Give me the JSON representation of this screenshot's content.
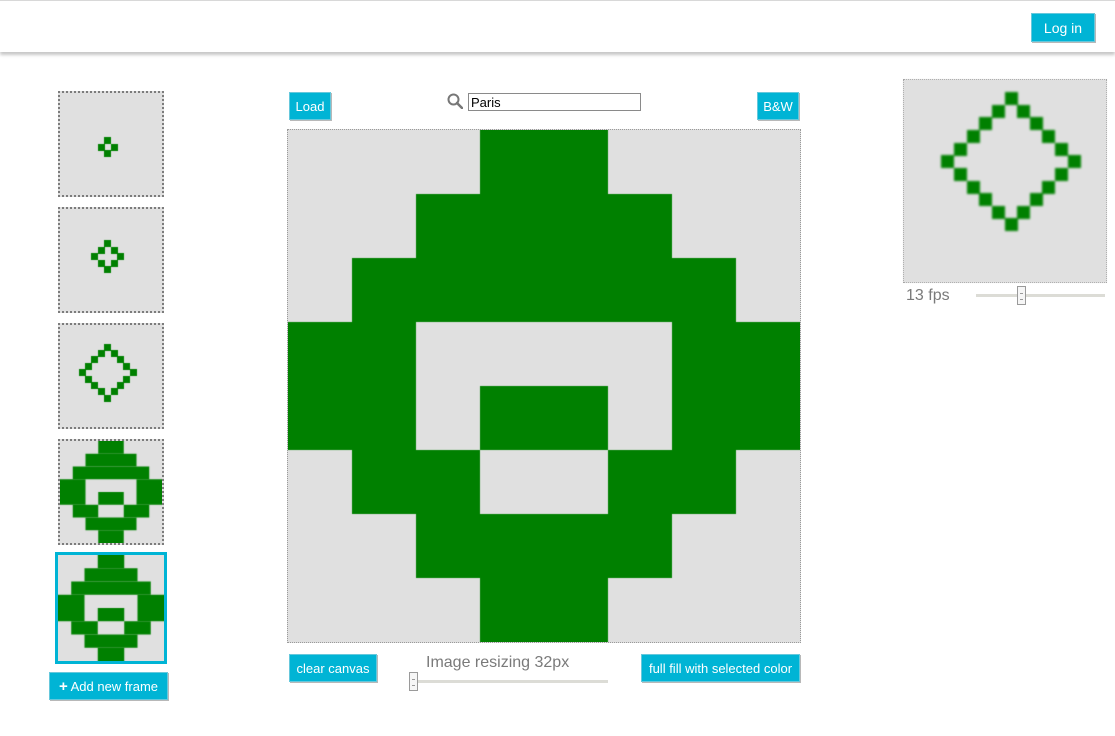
{
  "header": {
    "login_label": "Log in"
  },
  "toolbar": {
    "load_label": "Load",
    "bw_label": "B&W",
    "search_value": "Paris"
  },
  "bottom": {
    "clear_label": "clear canvas",
    "resize_label": "Image resizing 32px",
    "fill_label": "full fill with selected color",
    "resize_slider_value": 0
  },
  "frames_panel": {
    "add_frame_label": "Add new frame",
    "selected_index": 4
  },
  "preview": {
    "fps_label": "13 fps",
    "fps_slider_value": 0.34
  },
  "colors": {
    "pixel": "#008000",
    "background": "#e0e0e0",
    "accent": "#00b4d5"
  },
  "frames": [
    {
      "size": 16,
      "pixels": [
        [
          7,
          7
        ],
        [
          6,
          8
        ],
        [
          8,
          8
        ],
        [
          7,
          9
        ]
      ]
    },
    {
      "size": 16,
      "pixels": [
        [
          7,
          5
        ],
        [
          6,
          6
        ],
        [
          8,
          6
        ],
        [
          5,
          7
        ],
        [
          9,
          7
        ],
        [
          6,
          8
        ],
        [
          8,
          8
        ],
        [
          7,
          9
        ]
      ]
    },
    {
      "size": 16,
      "pixels": [
        [
          7,
          3
        ],
        [
          6,
          4
        ],
        [
          8,
          4
        ],
        [
          5,
          5
        ],
        [
          9,
          5
        ],
        [
          4,
          6
        ],
        [
          10,
          6
        ],
        [
          3,
          7
        ],
        [
          11,
          7
        ],
        [
          4,
          8
        ],
        [
          10,
          8
        ],
        [
          5,
          9
        ],
        [
          9,
          9
        ],
        [
          6,
          10
        ],
        [
          8,
          10
        ],
        [
          7,
          11
        ]
      ]
    },
    {
      "size": 8,
      "rects": [
        [
          3,
          0,
          2,
          1
        ],
        [
          2,
          1,
          4,
          1
        ],
        [
          1,
          2,
          6,
          1
        ],
        [
          0,
          3,
          2,
          2
        ],
        [
          6,
          3,
          2,
          2
        ],
        [
          3,
          4,
          2,
          1
        ],
        [
          1,
          5,
          2,
          1
        ],
        [
          5,
          5,
          2,
          1
        ],
        [
          2,
          6,
          4,
          1
        ],
        [
          3,
          7,
          2,
          1
        ]
      ]
    },
    {
      "size": 8,
      "rects": [
        [
          3,
          0,
          2,
          1
        ],
        [
          2,
          1,
          4,
          1
        ],
        [
          1,
          2,
          6,
          1
        ],
        [
          0,
          3,
          2,
          2
        ],
        [
          6,
          3,
          2,
          2
        ],
        [
          3,
          4,
          2,
          1
        ],
        [
          1,
          5,
          2,
          1
        ],
        [
          5,
          5,
          2,
          1
        ],
        [
          2,
          6,
          4,
          1
        ],
        [
          3,
          7,
          2,
          1
        ]
      ]
    }
  ],
  "editor": {
    "size": 8,
    "rects": [
      [
        3,
        0,
        2,
        1
      ],
      [
        2,
        1,
        4,
        1
      ],
      [
        1,
        2,
        6,
        1
      ],
      [
        0,
        3,
        2,
        2
      ],
      [
        6,
        3,
        2,
        2
      ],
      [
        3,
        4,
        2,
        1
      ],
      [
        1,
        5,
        2,
        1
      ],
      [
        5,
        5,
        2,
        1
      ],
      [
        2,
        6,
        4,
        1
      ],
      [
        3,
        7,
        2,
        1
      ]
    ]
  },
  "preview_frame": {
    "size": 16,
    "pixels": [
      [
        8,
        1
      ],
      [
        7,
        2
      ],
      [
        9,
        2
      ],
      [
        6,
        3
      ],
      [
        10,
        3
      ],
      [
        5,
        4
      ],
      [
        11,
        4
      ],
      [
        4,
        5
      ],
      [
        12,
        5
      ],
      [
        3,
        6
      ],
      [
        13,
        6
      ],
      [
        4,
        7
      ],
      [
        12,
        7
      ],
      [
        5,
        8
      ],
      [
        11,
        8
      ],
      [
        6,
        9
      ],
      [
        10,
        9
      ],
      [
        7,
        10
      ],
      [
        9,
        10
      ],
      [
        8,
        11
      ]
    ]
  }
}
